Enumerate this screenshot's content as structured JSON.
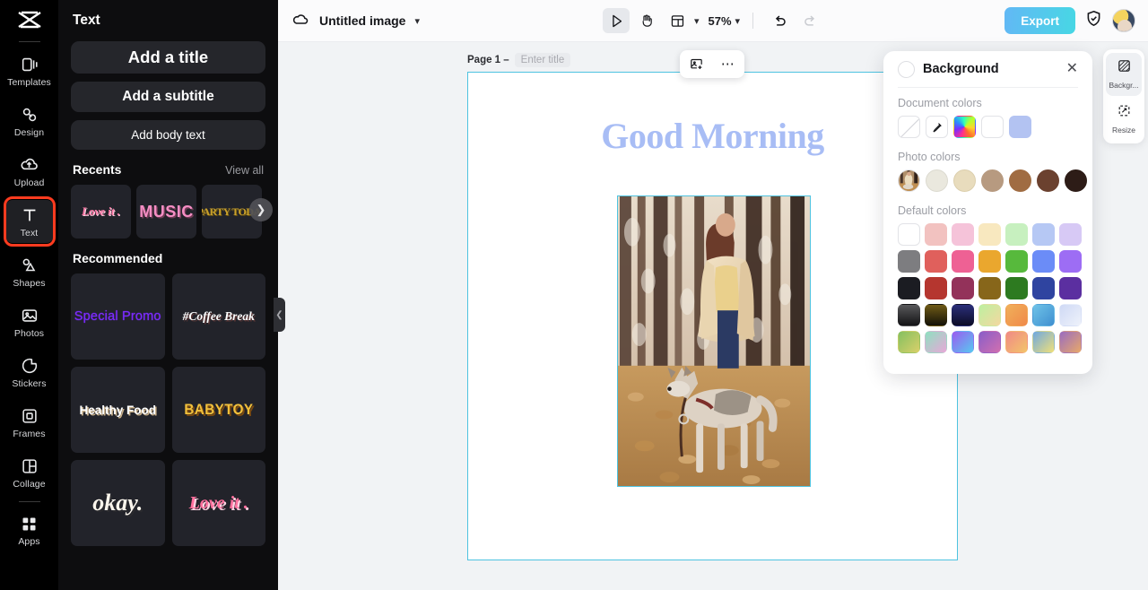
{
  "rail": {
    "logo_icon": "capcut-logo-icon",
    "items": [
      {
        "label": "Templates",
        "icon": "templates-icon",
        "active": false
      },
      {
        "label": "Design",
        "icon": "design-icon",
        "active": false
      },
      {
        "label": "Upload",
        "icon": "upload-cloud-icon",
        "active": false
      },
      {
        "label": "Text",
        "icon": "text-t-icon",
        "active": true
      },
      {
        "label": "Shapes",
        "icon": "shapes-icon",
        "active": false
      },
      {
        "label": "Photos",
        "icon": "photos-image-icon",
        "active": false
      },
      {
        "label": "Stickers",
        "icon": "sticker-icon",
        "active": false
      },
      {
        "label": "Frames",
        "icon": "frame-icon",
        "active": false
      },
      {
        "label": "Collage",
        "icon": "collage-icon",
        "active": false
      },
      {
        "label": "Apps",
        "icon": "apps-grid-icon",
        "active": false
      }
    ]
  },
  "text_panel": {
    "title": "Text",
    "add_title": "Add a title",
    "add_subtitle": "Add a subtitle",
    "add_body": "Add body text",
    "recents_heading": "Recents",
    "view_all": "View all",
    "recents": [
      {
        "label": "Love it .",
        "style": "s-loveit"
      },
      {
        "label": "MUSIC",
        "style": "s-music"
      },
      {
        "label": "PARTY TODAY",
        "style": "s-party"
      }
    ],
    "carousel_next_icon": "chevron-right-icon",
    "recommended_heading": "Recommended",
    "recommended": [
      {
        "label": "Special Promo",
        "style": "s-promo"
      },
      {
        "label": "#Coffee Break",
        "style": "s-coffee"
      },
      {
        "label": "Healthy Food",
        "style": "s-healthy"
      },
      {
        "label": "BABYTOY",
        "style": "s-baby"
      },
      {
        "label": "okay.",
        "style": "s-okay"
      },
      {
        "label": "Love it .",
        "style": "s-loveit2"
      }
    ],
    "collapse_icon": "chevron-left-icon"
  },
  "topbar": {
    "cloud_icon": "cloud-saved-icon",
    "doc_title": "Untitled image",
    "title_chevron_icon": "chevron-down-icon",
    "tools": [
      {
        "name": "select-cursor-icon",
        "selected": true
      },
      {
        "name": "hand-pan-icon",
        "selected": false
      },
      {
        "name": "layout-grid-icon",
        "selected": false
      }
    ],
    "layout_chevron_icon": "chevron-down-icon",
    "zoom_value": "57%",
    "zoom_chevron_icon": "chevron-down-icon",
    "undo_icon": "undo-arrow-icon",
    "redo_icon": "redo-arrow-icon",
    "export_label": "Export",
    "shield_icon": "shield-check-icon",
    "avatar_icon": "user-avatar"
  },
  "stage": {
    "page_prefix": "Page 1 –",
    "page_title_placeholder": "Enter title",
    "canvas_title": "Good Morning",
    "canvas_title_color": "#a8bdf5",
    "selection_color": "#4ec3e0",
    "float_toolbar": {
      "replace_image_icon": "replace-image-icon",
      "more_icon": "more-options-ellipsis-icon"
    },
    "photo_alt": "woman-with-husky-dog-in-autumn-forest"
  },
  "background_panel": {
    "title": "Background",
    "current_swatch": "#ffffff",
    "close_icon": "close-x-icon",
    "document_colors_label": "Document colors",
    "document_colors": [
      {
        "name": "no-color",
        "value": "none"
      },
      {
        "name": "eyedropper",
        "value": "picker"
      },
      {
        "name": "custom-color-wheel",
        "value": "rainbow"
      },
      {
        "name": "white",
        "value": "#ffffff"
      },
      {
        "name": "periwinkle",
        "value": "#b3c3f2"
      }
    ],
    "photo_colors_label": "Photo colors",
    "photo_colors": [
      {
        "name": "source-photo",
        "value": "photo"
      },
      {
        "name": "off-white",
        "value": "#eae8de"
      },
      {
        "name": "cream",
        "value": "#e8dcbd"
      },
      {
        "name": "tan",
        "value": "#b79a80"
      },
      {
        "name": "medium-brown",
        "value": "#a06c42"
      },
      {
        "name": "dark-brown",
        "value": "#6b412f"
      },
      {
        "name": "near-black-brown",
        "value": "#2d1c17"
      }
    ],
    "default_colors_label": "Default colors",
    "default_colors": [
      [
        "#ffffff",
        "#f2c2c0",
        "#f5c3d9",
        "#f8e8bf",
        "#c7f0bf",
        "#b6c8f4",
        "#d7c9f5"
      ],
      [
        "#7d7d80",
        "#e0605c",
        "#ee6194",
        "#eaa72e",
        "#57b93c",
        "#6b8cf7",
        "#9d6df4"
      ],
      [
        "#1b1c22",
        "#b5362f",
        "#93325a",
        "#87661a",
        "#2d7a20",
        "#2f44a0",
        "#5b2fa0"
      ],
      [
        "linear-gradient(180deg,#58585a,#131316)",
        "linear-gradient(180deg,#6f5a16,#141208)",
        "linear-gradient(180deg,#2b2f7a,#0c0c26)",
        "linear-gradient(135deg,#bdf0a0,#f3d8a0)",
        "linear-gradient(135deg,#f0b05a,#f08a4a)",
        "linear-gradient(135deg,#6fc3e8,#3f8fd0)",
        "linear-gradient(135deg,#cfd9f5,#eef2fb)"
      ],
      [
        "linear-gradient(135deg,#85c060,#d9d06a)",
        "linear-gradient(135deg,#8fe0c0,#e8a8d8)",
        "linear-gradient(135deg,#9a5cf0,#58c8f0)",
        "linear-gradient(135deg,#8a5ec8,#d06fb0)",
        "linear-gradient(135deg,#f08a86,#f3c46a)",
        "linear-gradient(135deg,#6fa8e0,#efe07a)",
        "linear-gradient(135deg,#9a6cc0,#e8a86a)"
      ]
    ]
  },
  "dock": {
    "items": [
      {
        "label": "Backgr...",
        "icon": "background-hatch-icon",
        "selected": true
      },
      {
        "label": "Resize",
        "icon": "resize-icon",
        "selected": false
      }
    ]
  }
}
